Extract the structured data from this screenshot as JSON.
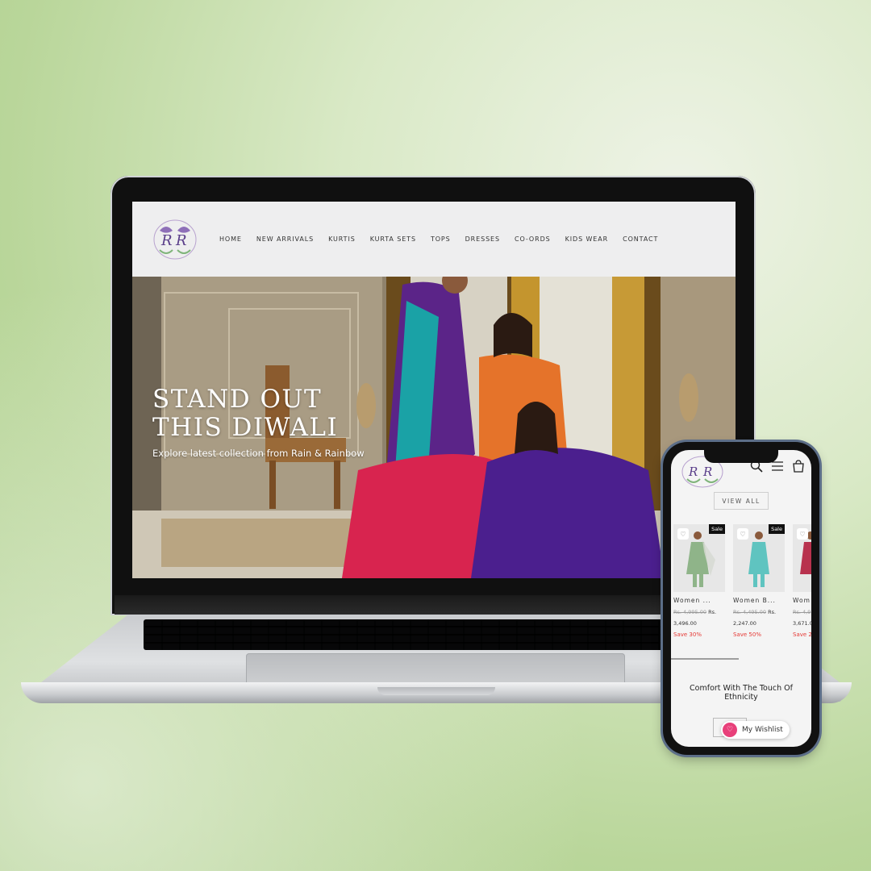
{
  "desktop": {
    "nav": [
      "HOME",
      "NEW ARRIVALS",
      "KURTIS",
      "KURTA SETS",
      "TOPS",
      "DRESSES",
      "CO-ORDS",
      "KIDS WEAR",
      "CONTACT"
    ],
    "hero": {
      "title_line1": "STAND OUT",
      "title_line2": "THIS DIWALI",
      "subtitle": "Explore latest collection from Rain & Rainbow"
    }
  },
  "mobile": {
    "view_all": "VIEW ALL",
    "products": [
      {
        "name": "Women ...",
        "old_price": "Rs. 4,995.00",
        "price_prefix": "Rs.",
        "price": "3,496.00",
        "save": "Save 30%",
        "badge": "Sale"
      },
      {
        "name": "Women B...",
        "old_price": "Rs. 4,495.00",
        "price_prefix": "Rs.",
        "price": "2,247.00",
        "save": "Save 50%",
        "badge": "Sale"
      },
      {
        "name": "Wom",
        "old_price": "Rs. 4,9",
        "price_prefix": "",
        "price": "3,671.0",
        "save": "Save 2",
        "badge": ""
      }
    ],
    "tagline": "Comfort With The Touch Of Ethnicity",
    "wishlist": "My Wishlist",
    "icons": [
      "search-icon",
      "menu-icon",
      "cart-icon",
      "heart-icon"
    ]
  }
}
